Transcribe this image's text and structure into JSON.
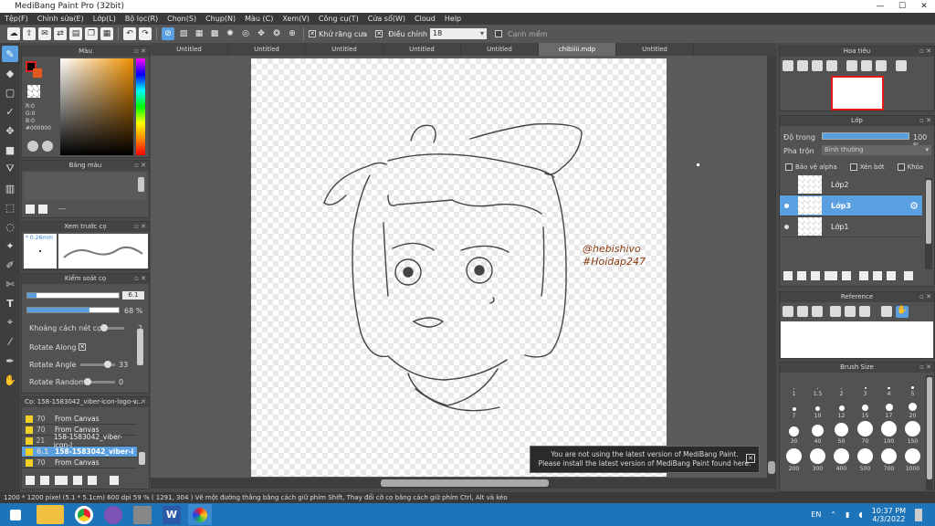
{
  "window": {
    "title": "MediBang Paint Pro (32bit)",
    "min": "—",
    "max": "☐",
    "close": "✕"
  },
  "menu": [
    "Tệp(F)",
    "Chỉnh sửa(E)",
    "Lớp(L)",
    "Bộ lọc(R)",
    "Chọn(S)",
    "Chụp(N)",
    "Màu (C)",
    "Xem(V)",
    "Công cụ(T)",
    "Cửa sổ(W)",
    "Cloud",
    "Help"
  ],
  "toolbar": {
    "antialias_label": "Khử răng cưa",
    "correction_label": "Điều chỉnh",
    "correction_value": "18",
    "smooth_label": "Cạnh mềm"
  },
  "color_panel": {
    "title": "Màu",
    "r": "R:0",
    "g": "G:0",
    "b": "B:0",
    "hex": "#000000",
    "accent": "#5aa0e0"
  },
  "palette_panel": {
    "title": "Bảng màu",
    "dash": "---"
  },
  "brush_preview": {
    "title": "Xem trước cọ",
    "size": "0.26mm"
  },
  "brush_control": {
    "title": "Kiểm soát cọ",
    "size_value": "6.1",
    "opacity_value": "68 %",
    "spacing_label": "Khoảng cách nét cọ",
    "spacing_value": "2",
    "rotate_along_label": "Rotate Along",
    "rotate_angle_label": "Rotate Angle",
    "rotate_angle_value": "33",
    "rotate_random_label": "Rotate Random",
    "rotate_random_value": "0"
  },
  "brush_list": {
    "title": "Cọ: 158-1583042_viber-icon-logo-v...",
    "rows": [
      {
        "n": "70",
        "label": "From Canvas"
      },
      {
        "n": "70",
        "label": "From Canvas"
      },
      {
        "n": "21",
        "label": "158-1583042_viber-icon-l"
      },
      {
        "n": "6.1",
        "label": "158-1583042_viber-i"
      },
      {
        "n": "70",
        "label": "From Canvas"
      }
    ]
  },
  "tabs": [
    "Untitled",
    "Untitled",
    "Untitled",
    "Untitled",
    "Untitled",
    "chibiiii.mdp",
    "Untitled"
  ],
  "canvas": {
    "sig1": "@hebishivo",
    "sig2": "#Hoidap247"
  },
  "notice": {
    "line1": "You are not using the latest version of MediBang Paint.",
    "line2": "Please install the latest version of MediBang Paint found here.",
    "close": "✕"
  },
  "navigator": {
    "title": "Hoa tiêu"
  },
  "layer_panel": {
    "title": "Lớp",
    "opacity_label": "Độ trong",
    "opacity_value": "100 %",
    "blend_label": "Pha trộn",
    "blend_value": "Bình thường",
    "protect_alpha": "Bảo vệ alpha",
    "clipping": "Xén bớt",
    "lock": "Khóa",
    "layers": [
      {
        "name": "Lớp2",
        "selected": false
      },
      {
        "name": "Lớp3",
        "selected": true
      },
      {
        "name": "Lớp1",
        "selected": false
      }
    ]
  },
  "reference": {
    "title": "Reference"
  },
  "brush_size": {
    "title": "Brush Size",
    "sizes": [
      "1",
      "1.5",
      "2",
      "3",
      "4",
      "5",
      "7",
      "10",
      "12",
      "15",
      "17",
      "20",
      "30",
      "40",
      "50",
      "70",
      "100",
      "150",
      "200",
      "300",
      "400",
      "500",
      "700",
      "1000"
    ]
  },
  "status": "1200 * 1200 pixel   (5.1 * 5.1cm)  600 dpi   59 %   ( 1291, 304 )   Vẽ một đường thẳng bằng cách giữ phím Shift, Thay đổi cỡ cọ bằng cách giữ phím Ctrl, Alt và kéo",
  "taskbar": {
    "lang": "EN",
    "time": "10:37 PM",
    "date": "4/3/2022"
  }
}
